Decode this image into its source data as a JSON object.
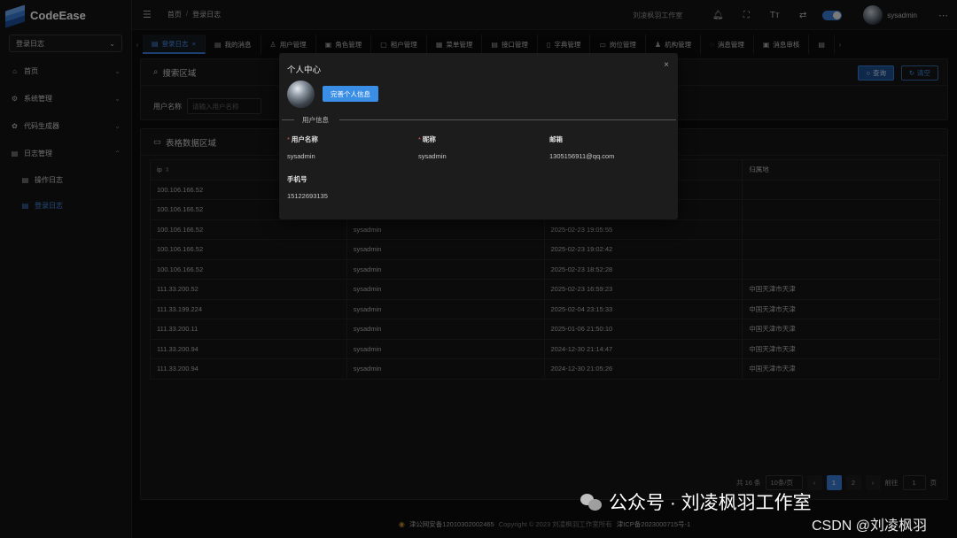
{
  "app": {
    "name": "CodeEase"
  },
  "sidebar": {
    "select_value": "登录日志",
    "items": [
      {
        "label": "首页",
        "icon": "home-icon"
      },
      {
        "label": "系统管理",
        "icon": "gear-icon"
      },
      {
        "label": "代码生成器",
        "icon": "gear-icon"
      },
      {
        "label": "日志管理",
        "icon": "document-icon"
      },
      {
        "label": "操作日志",
        "icon": "document-icon"
      },
      {
        "label": "登录日志",
        "icon": "document-icon"
      }
    ]
  },
  "header": {
    "breadcrumb": [
      "首页",
      "登录日志"
    ],
    "studio_name": "刘凌枫羽工作室",
    "username": "sysadmin"
  },
  "tabs": [
    {
      "label": "登录日志",
      "active": true
    },
    {
      "label": "我的消息"
    },
    {
      "label": "用户管理"
    },
    {
      "label": "角色管理"
    },
    {
      "label": "租户管理"
    },
    {
      "label": "菜单管理"
    },
    {
      "label": "接口管理"
    },
    {
      "label": "字典管理"
    },
    {
      "label": "岗位管理"
    },
    {
      "label": "机构管理"
    },
    {
      "label": "消息管理"
    },
    {
      "label": "消息审核"
    }
  ],
  "search": {
    "title": "搜索区域",
    "field_label": "用户名称",
    "placeholder": "请输入用户名称",
    "query_label": "查询",
    "clear_label": "清空"
  },
  "table": {
    "title": "表格数据区域",
    "columns": [
      "ip",
      "",
      "",
      "归属地"
    ],
    "rows": [
      [
        "100.106.166.52",
        "",
        "",
        ""
      ],
      [
        "100.106.166.52",
        "",
        "",
        ""
      ],
      [
        "100.106.166.52",
        "sysadmin",
        "2025-02-23 19:05:55",
        ""
      ],
      [
        "100.106.166.52",
        "sysadmin",
        "2025-02-23 19:02:42",
        ""
      ],
      [
        "100.106.166.52",
        "sysadmin",
        "2025-02-23 18:52:28",
        ""
      ],
      [
        "111.33.200.52",
        "sysadmin",
        "2025-02-23 16:59:23",
        "中国天津市天津"
      ],
      [
        "111.33.199.224",
        "sysadmin",
        "2025-02-04 23:15:33",
        "中国天津市天津"
      ],
      [
        "111.33.200.11",
        "sysadmin",
        "2025-01-06 21:50:10",
        "中国天津市天津"
      ],
      [
        "111.33.200.94",
        "sysadmin",
        "2024-12-30 21:14:47",
        "中国天津市天津"
      ],
      [
        "111.33.200.94",
        "sysadmin",
        "2024-12-30 21:05:26",
        "中国天津市天津"
      ]
    ]
  },
  "pager": {
    "total": "共 16 条",
    "page_size": "10条/页",
    "pages": [
      "1",
      "2"
    ],
    "goto_label": "前往",
    "goto_value": "1",
    "page_unit": "页"
  },
  "footer": {
    "police": "津公网安备12010302002465",
    "copyright": "Copyright © 2023 刘凌枫羽工作室所有",
    "icp": "津ICP备2023000715号-1"
  },
  "dialog": {
    "title": "个人中心",
    "complete_button": "完善个人信息",
    "section_label": "用户信息",
    "fields": [
      {
        "label": "用户名称",
        "value": "sysadmin",
        "required": true
      },
      {
        "label": "昵称",
        "value": "sysadmin",
        "required": true
      },
      {
        "label": "邮箱",
        "value": "1305156911@qq.com",
        "required": false
      },
      {
        "label": "手机号",
        "value": "15122693135",
        "required": false
      }
    ]
  },
  "watermark": {
    "text": "公众号 · 刘凌枫羽工作室",
    "csdn": "CSDN @刘凌枫羽"
  },
  "colors": {
    "accent": "#3a7bd5",
    "background": "#0d0d0d"
  }
}
